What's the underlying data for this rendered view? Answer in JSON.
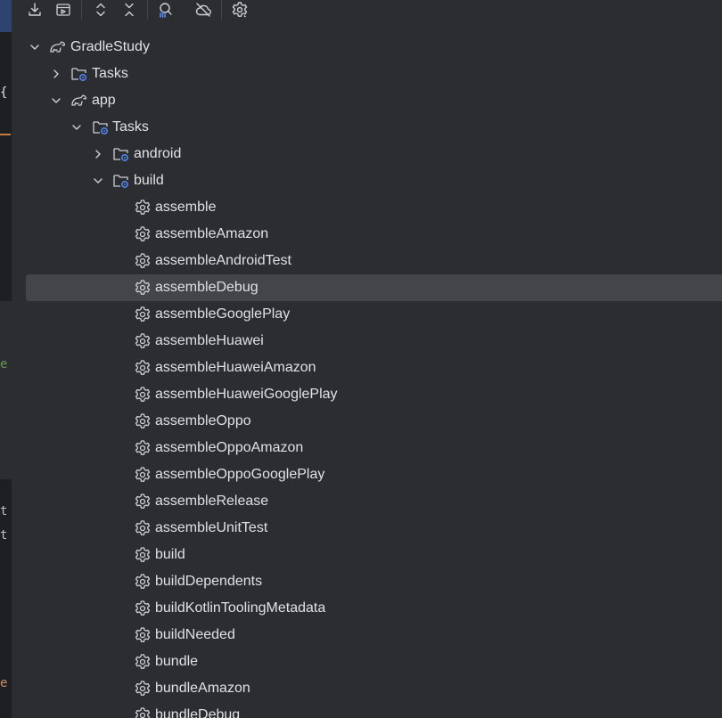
{
  "toolbar": {
    "buttons": [
      {
        "name": "download-icon"
      },
      {
        "name": "run-config-icon"
      },
      {
        "name": "expand-all-icon"
      },
      {
        "name": "collapse-all-icon"
      },
      {
        "name": "analyze-dependencies-icon"
      },
      {
        "name": "offline-mode-icon"
      },
      {
        "name": "build-settings-icon"
      }
    ]
  },
  "editor_fragments": {
    "brace": "{",
    "l1": "e",
    "l2": "t",
    "l3": "t",
    "l4": "e"
  },
  "tree": {
    "project": "GradleStudy",
    "project_tasks": "Tasks",
    "module": "app",
    "module_tasks": "Tasks",
    "group_android": "android",
    "group_build": "build",
    "tasks": [
      "assemble",
      "assembleAmazon",
      "assembleAndroidTest",
      "assembleDebug",
      "assembleGooglePlay",
      "assembleHuawei",
      "assembleHuaweiAmazon",
      "assembleHuaweiGooglePlay",
      "assembleOppo",
      "assembleOppoAmazon",
      "assembleOppoGooglePlay",
      "assembleRelease",
      "assembleUnitTest",
      "build",
      "buildDependents",
      "buildKotlinToolingMetadata",
      "buildNeeded",
      "bundle",
      "bundleAmazon",
      "bundleDebug"
    ],
    "selected_task": "assembleDebug"
  },
  "colors": {
    "background": "#2b2d30",
    "selection": "#43454a",
    "text": "#dfe1e5",
    "icon": "#ced0d6",
    "accent_blue": "#548af7"
  }
}
